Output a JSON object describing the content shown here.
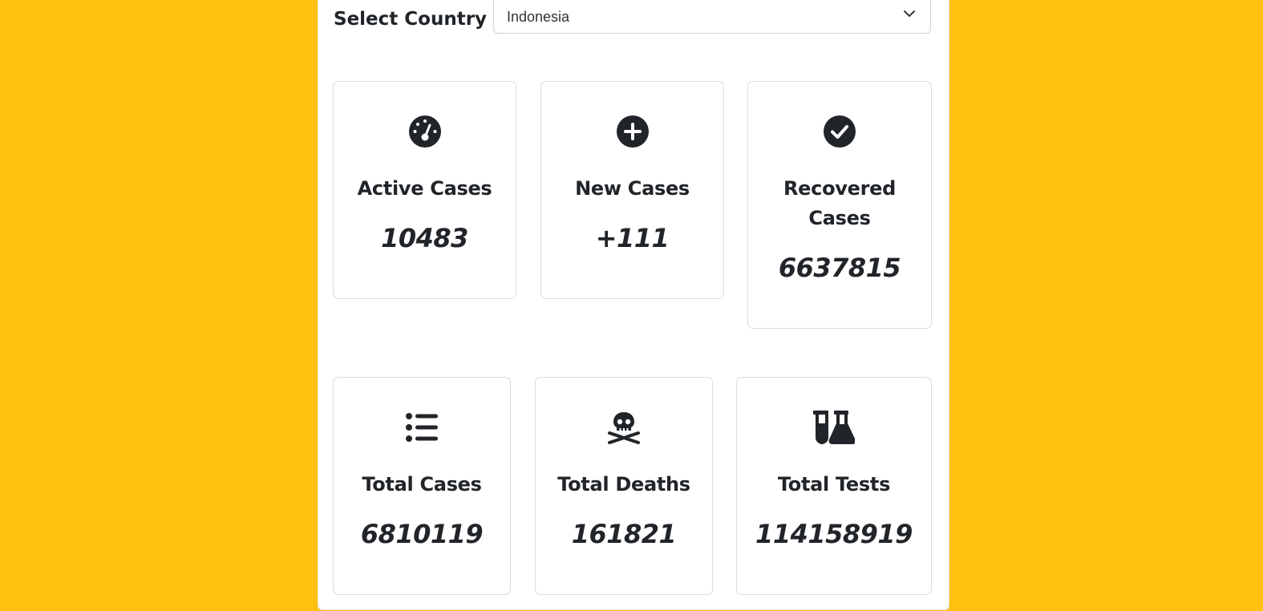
{
  "country_select": {
    "label": "Select Country",
    "selected": "Indonesia"
  },
  "stats": {
    "active": {
      "icon": "tachometer-icon",
      "title": "Active Cases",
      "value": "10483"
    },
    "new": {
      "icon": "plus-circle-icon",
      "title": "New Cases",
      "value": "+111"
    },
    "recovered": {
      "icon": "check-circle-icon",
      "title": "Recovered Cases",
      "value": "6637815"
    },
    "total_cases": {
      "icon": "list-icon",
      "title": "Total Cases",
      "value": "6810119"
    },
    "total_deaths": {
      "icon": "skull-crossbones-icon",
      "title": "Total Deaths",
      "value": "161821"
    },
    "total_tests": {
      "icon": "vials-flask-icon",
      "title": "Total Tests",
      "value": "114158919"
    }
  },
  "colors": {
    "background": "#FFC00E",
    "panel": "#FFFFFF",
    "text": "#212529",
    "border": "#DCDCDC"
  }
}
